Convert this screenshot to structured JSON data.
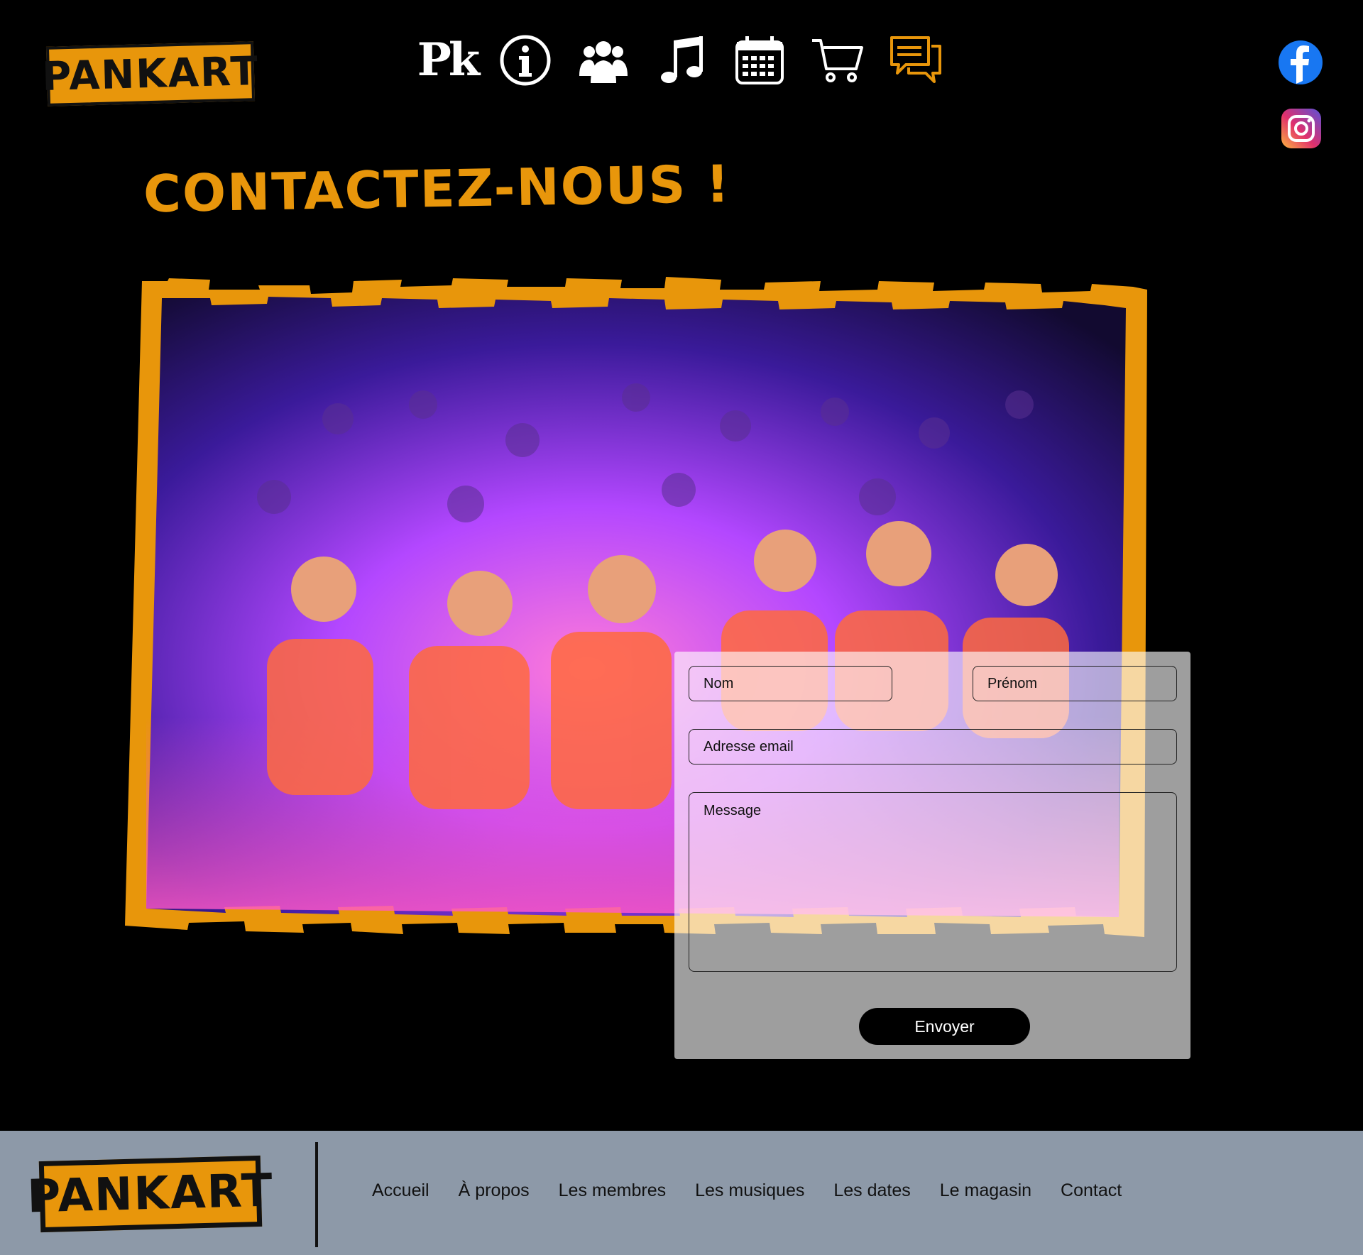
{
  "brand": {
    "logo_text": "PANKART"
  },
  "colors": {
    "accent": "#e8960b",
    "background": "#000000",
    "footer_bg": "#8d99a8",
    "form_bg": "rgba(255,255,255,0.62)"
  },
  "nav_icons": [
    {
      "name": "pk-logo-icon",
      "glyph": "Pk"
    },
    {
      "name": "info-icon"
    },
    {
      "name": "members-icon"
    },
    {
      "name": "music-note-icon"
    },
    {
      "name": "calendar-icon"
    },
    {
      "name": "cart-icon"
    },
    {
      "name": "chat-icon",
      "active": true
    }
  ],
  "social": [
    {
      "name": "facebook-icon"
    },
    {
      "name": "instagram-icon"
    }
  ],
  "page": {
    "title": "CONTACTEZ-NOUS !"
  },
  "form": {
    "nom_placeholder": "Nom",
    "prenom_placeholder": "Prénom",
    "email_placeholder": "Adresse email",
    "message_placeholder": "Message",
    "submit_label": "Envoyer"
  },
  "footer": {
    "links": [
      "Accueil",
      "À propos",
      "Les membres",
      "Les musiques",
      "Les dates",
      "Le magasin",
      "Contact"
    ]
  }
}
